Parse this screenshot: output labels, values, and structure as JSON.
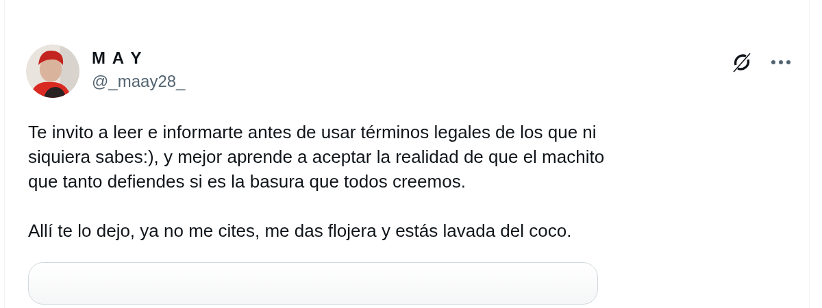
{
  "post": {
    "author": {
      "name": "M A Y",
      "handle": "@_maay28_"
    },
    "paragraphs": [
      "Te invito a leer e informarte antes de usar términos legales de los que ni\nsiquiera sabes:), y mejor aprende a aceptar la realidad de que el machito\nque tanto defiendes si es la basura que todos creemos.",
      "Allí te lo dejo, ya no me cites, me das flojera y estás lavada del coco."
    ],
    "quoted_post": {
      "kind": "card"
    }
  }
}
